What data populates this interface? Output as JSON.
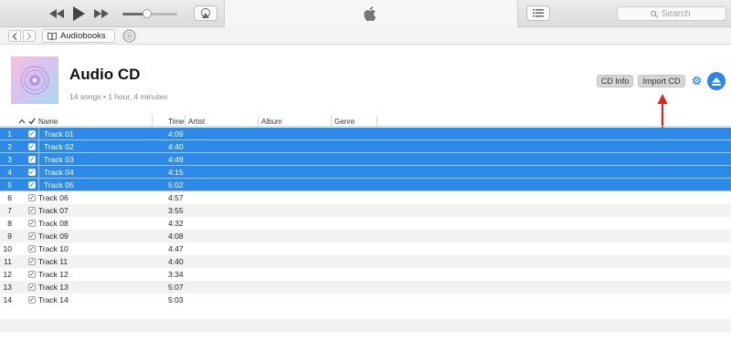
{
  "toolbar": {
    "search_placeholder": "Search",
    "volume_level": 0.45
  },
  "navbar": {
    "crumb_label": "Audiobooks"
  },
  "header": {
    "title": "Audio CD",
    "subtitle": "14 songs • 1 hour, 4 minutes",
    "cd_info_label": "CD Info",
    "import_label": "Import CD",
    "eject_color": "#2c86e8",
    "annotation_arrow_color": "#e0231b"
  },
  "table": {
    "columns": {
      "name": "Name",
      "time": "Time",
      "artist": "Artist",
      "album": "Album",
      "genre": "Genre"
    },
    "selection_color": "#2d8ae6",
    "tracks": [
      {
        "num": "1",
        "name": "Track 01",
        "time": "4:09",
        "selected": true
      },
      {
        "num": "2",
        "name": "Track 02",
        "time": "4:40",
        "selected": true
      },
      {
        "num": "3",
        "name": "Track 03",
        "time": "4:49",
        "selected": true
      },
      {
        "num": "4",
        "name": "Track 04",
        "time": "4:15",
        "selected": true
      },
      {
        "num": "5",
        "name": "Track 05",
        "time": "5:02",
        "selected": true
      },
      {
        "num": "6",
        "name": "Track 06",
        "time": "4:57",
        "selected": false
      },
      {
        "num": "7",
        "name": "Track 07",
        "time": "3:55",
        "selected": false
      },
      {
        "num": "8",
        "name": "Track 08",
        "time": "4:32",
        "selected": false
      },
      {
        "num": "9",
        "name": "Track 09",
        "time": "4:08",
        "selected": false
      },
      {
        "num": "10",
        "name": "Track 10",
        "time": "4:47",
        "selected": false
      },
      {
        "num": "11",
        "name": "Track 11",
        "time": "4:40",
        "selected": false
      },
      {
        "num": "12",
        "name": "Track 12",
        "time": "3:34",
        "selected": false
      },
      {
        "num": "13",
        "name": "Track 13",
        "time": "5:07",
        "selected": false
      },
      {
        "num": "14",
        "name": "Track 14",
        "time": "5:03",
        "selected": false
      }
    ]
  }
}
